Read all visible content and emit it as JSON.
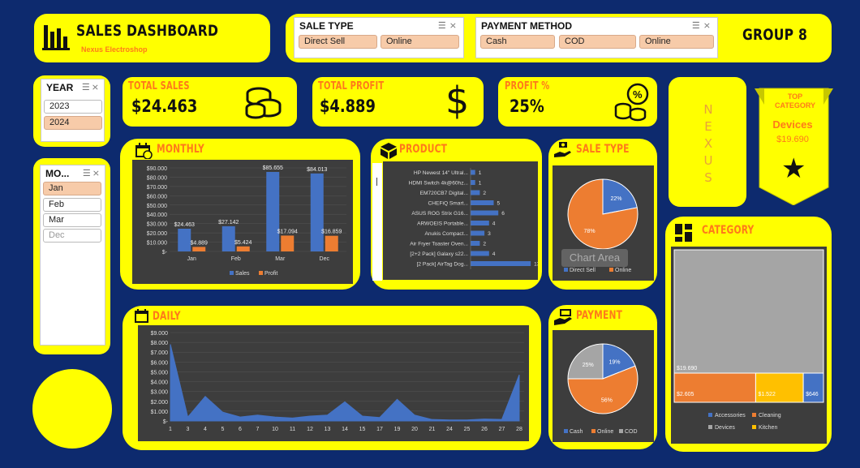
{
  "header": {
    "title": "SALES DASHBOARD",
    "subtitle": "Nexus Electroshop",
    "group": "GROUP 8"
  },
  "slicers": {
    "sale_type": {
      "title": "SALE TYPE",
      "items": [
        "Direct Sell",
        "Online"
      ]
    },
    "payment_method": {
      "title": "PAYMENT METHOD",
      "items": [
        "Cash",
        "COD",
        "Online"
      ]
    },
    "year": {
      "title": "YEAR",
      "items": [
        {
          "label": "2023",
          "state": "normal"
        },
        {
          "label": "2024",
          "state": "selected"
        }
      ]
    },
    "month": {
      "title": "MO...",
      "items": [
        {
          "label": "Jan",
          "state": "selected"
        },
        {
          "label": "Feb",
          "state": "normal"
        },
        {
          "label": "Mar",
          "state": "normal"
        },
        {
          "label": "Dec",
          "state": "dimmed"
        }
      ]
    }
  },
  "kpis": {
    "total_sales": {
      "label": "TOTAL SALES",
      "value": "$24.463"
    },
    "total_profit": {
      "label": "TOTAL PROFIT",
      "value": "$4.889"
    },
    "profit_pct": {
      "label": "PROFIT %",
      "value": "25%"
    }
  },
  "nexus_vertical": "N E X U S",
  "top_category": {
    "label": "TOP CATEGORY",
    "name": "Devices",
    "value": "$19.690"
  },
  "sections": {
    "monthly": "MONTHLY",
    "product": "PRODUCT",
    "sale_type": "SALE TYPE",
    "daily": "DAILY",
    "payment": "PAYMENT",
    "category": "CATEGORY"
  },
  "chart_area_tooltip": "Chart Area",
  "chart_data": [
    {
      "id": "monthly",
      "type": "bar",
      "categories": [
        "Jan",
        "Feb",
        "Mar",
        "Dec"
      ],
      "series": [
        {
          "name": "Sales",
          "values": [
            24463,
            27142,
            85655,
            84013
          ],
          "labels": [
            "$24.463",
            "$27.142",
            "$85.655",
            "$84.013"
          ],
          "color": "#4472c4"
        },
        {
          "name": "Profit",
          "values": [
            4889,
            5424,
            17094,
            16859
          ],
          "labels": [
            "$4.889",
            "$5.424",
            "$17.094",
            "$16.859"
          ],
          "color": "#ed7d31"
        }
      ],
      "yticks": [
        "$90.000",
        "$80.000",
        "$70.000",
        "$60.000",
        "$50.000",
        "$40.000",
        "$30.000",
        "$20.000",
        "$10.000",
        "$-"
      ],
      "ylim": [
        0,
        90000
      ]
    },
    {
      "id": "product",
      "type": "bar",
      "orientation": "horizontal",
      "categories": [
        "HP Newest 14\" Ultral...",
        "HDMI Switch 4k@60hz...",
        "EM720CB7 Digital...",
        "CHEFiQ Smart...",
        "ASUS ROG Strix G16...",
        "ARWOEIS Portable...",
        "Anukis Compact...",
        "Air Fryer Toaster Oven...",
        "[2+2 Pack] Galaxy s22...",
        "[2 Pack] AirTag Dog..."
      ],
      "values": [
        1,
        1,
        2,
        5,
        6,
        4,
        3,
        2,
        4,
        13
      ],
      "color": "#4472c4",
      "xlim": [
        0,
        14
      ]
    },
    {
      "id": "sale_type",
      "type": "pie",
      "categories": [
        "Direct Sell",
        "Online"
      ],
      "values": [
        22,
        78
      ],
      "labels": [
        "22%",
        "78%"
      ],
      "colors": [
        "#4472c4",
        "#ed7d31"
      ]
    },
    {
      "id": "daily",
      "type": "area",
      "x": [
        "1",
        "3",
        "4",
        "5",
        "6",
        "7",
        "10",
        "11",
        "12",
        "13",
        "14",
        "15",
        "17",
        "19",
        "20",
        "21",
        "24",
        "25",
        "26",
        "27",
        "28"
      ],
      "values": [
        7800,
        400,
        2500,
        900,
        400,
        600,
        400,
        300,
        500,
        600,
        1950,
        500,
        350,
        2200,
        600,
        150,
        100,
        100,
        200,
        150,
        4700
      ],
      "yticks": [
        "$9.000",
        "$8.000",
        "$7.000",
        "$6.000",
        "$5.000",
        "$4.000",
        "$3.000",
        "$2.000",
        "$1.000",
        "$-"
      ],
      "ylim": [
        0,
        9000
      ],
      "color": "#4472c4"
    },
    {
      "id": "payment",
      "type": "pie",
      "categories": [
        "Cash",
        "Online",
        "COD"
      ],
      "values": [
        19,
        56,
        25
      ],
      "labels": [
        "19%",
        "56%",
        "25%"
      ],
      "colors": [
        "#4472c4",
        "#ed7d31",
        "#a5a5a5"
      ]
    },
    {
      "id": "category",
      "type": "treemap",
      "categories": [
        "Devices",
        "Cleaning",
        "Kitchen",
        "Accessories"
      ],
      "values": [
        19690,
        2605,
        1522,
        646
      ],
      "labels": [
        "$19.690",
        "$2.605",
        "$1.522",
        "$646"
      ],
      "colors": [
        "#a5a5a5",
        "#ed7d31",
        "#ffc000",
        "#4472c4"
      ],
      "legend": [
        "Accessories",
        "Cleaning",
        "Devices",
        "Kitchen"
      ]
    }
  ]
}
